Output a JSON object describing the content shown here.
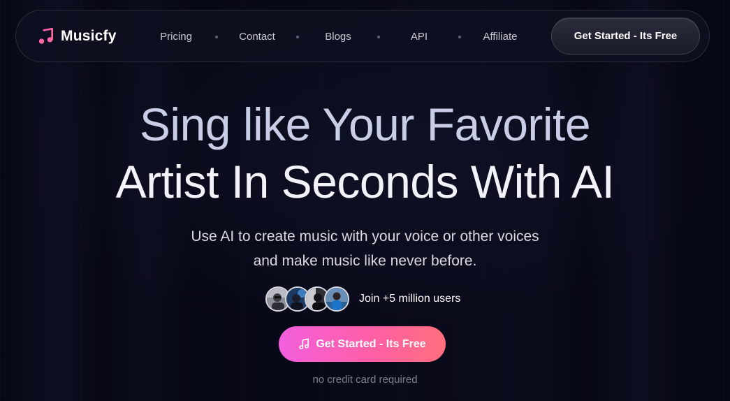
{
  "brand": {
    "name": "Musicfy",
    "icon": "music-note-icon",
    "icon_gradient": [
      "#ff5fbf",
      "#ff6f8d"
    ]
  },
  "nav": {
    "links": [
      "Pricing",
      "Contact",
      "Blogs",
      "API",
      "Affiliate"
    ],
    "cta_label": "Get Started - Its Free"
  },
  "hero": {
    "title_line1": "Sing like Your Favorite",
    "title_line2": "Artist In Seconds With AI",
    "subtitle_line1": "Use AI to create music with your voice or other voices",
    "subtitle_line2": "and make music like never before.",
    "social_proof": "Join +5 million users",
    "avatars": [
      "avatar-user-1",
      "avatar-user-2",
      "avatar-user-3",
      "avatar-user-4"
    ],
    "cta_label": "Get Started - Its Free",
    "cta_icon": "music-note-icon",
    "note": "no credit card required"
  },
  "colors": {
    "background": "#070816",
    "accent_start": "#f35fde",
    "accent_end": "#ff6f7d"
  }
}
